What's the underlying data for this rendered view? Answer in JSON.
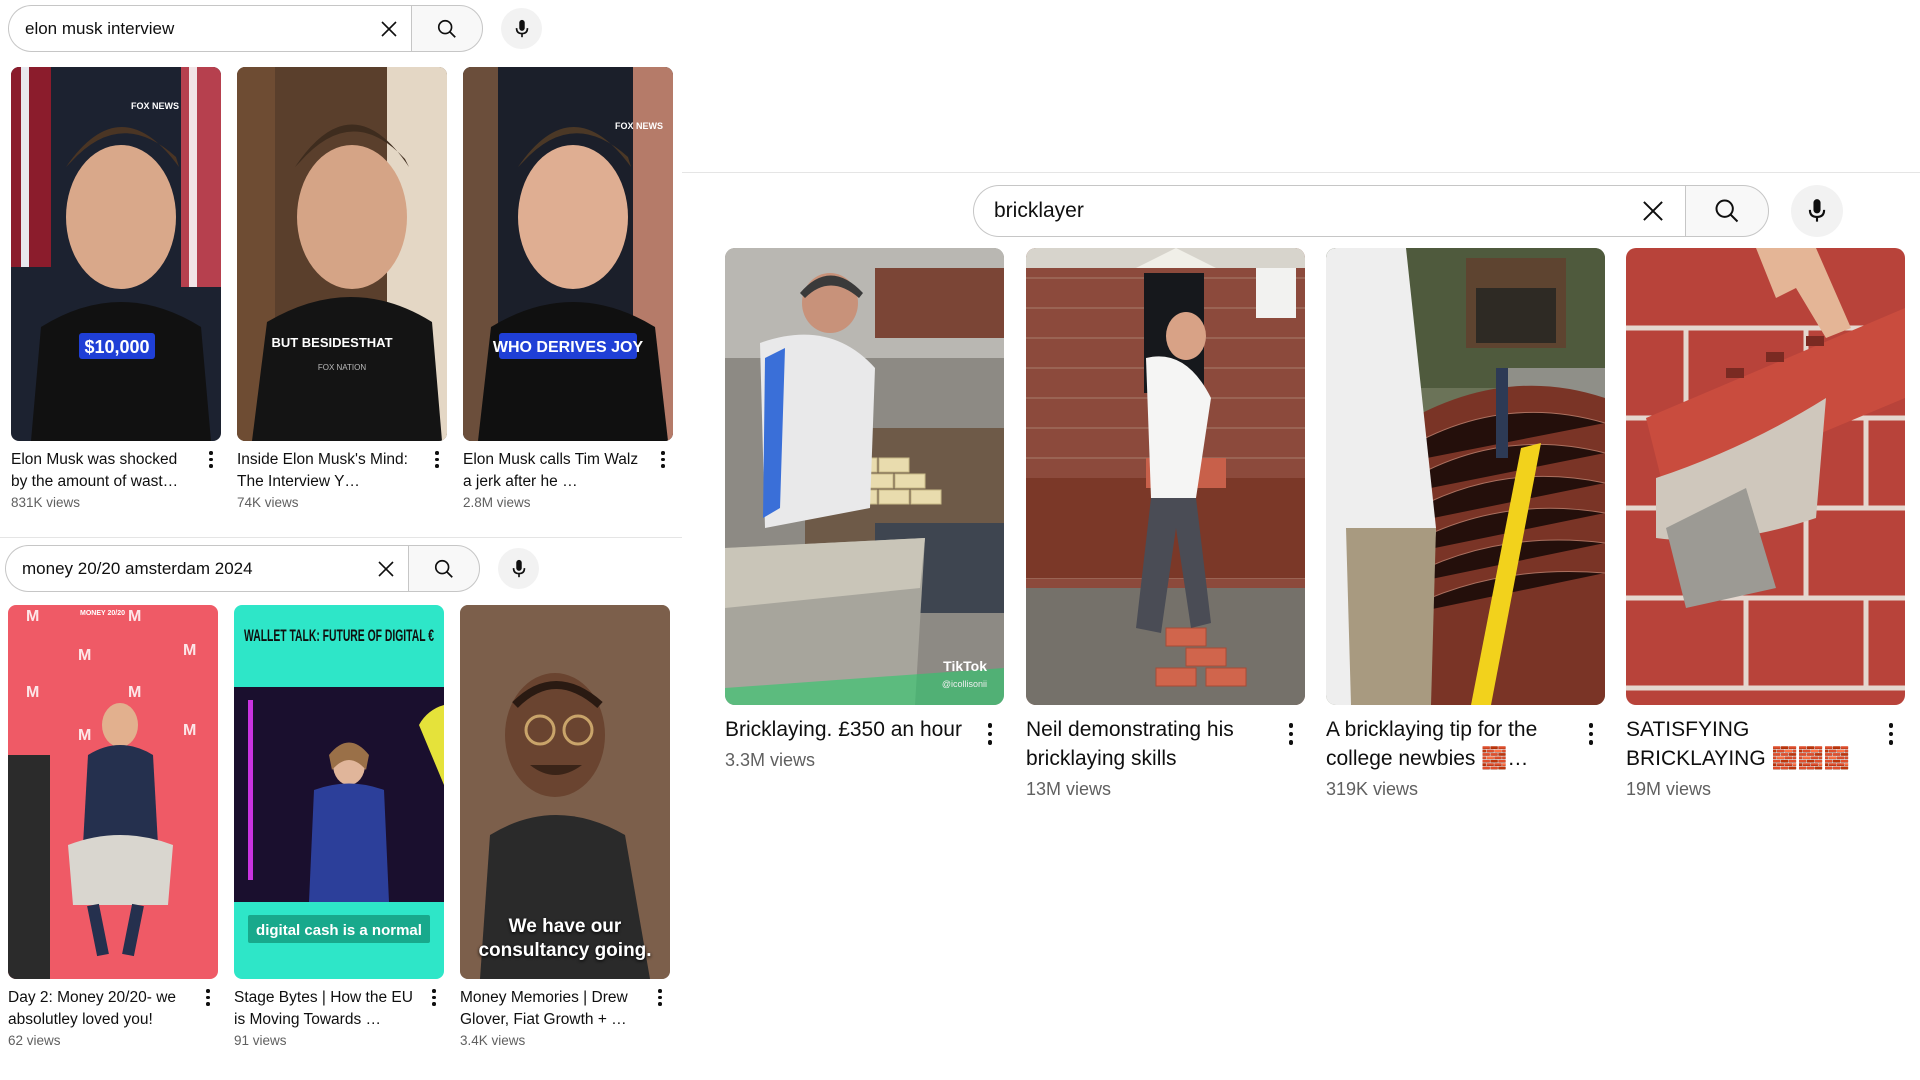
{
  "section1": {
    "search": {
      "query": "elon musk interview"
    },
    "videos": [
      {
        "title": "Elon Musk was shocked by the amount of wast…",
        "views": "831K views",
        "badge": "FOX NEWS",
        "caption": "$10,000"
      },
      {
        "title": "Inside Elon Musk's Mind: The Interview Y…",
        "views": "74K views",
        "caption": "BUT BESIDESTHAT",
        "sub_caption": "FOX NATION"
      },
      {
        "title": "Elon Musk calls Tim Walz a jerk after he …",
        "views": "2.8M views",
        "badge": "FOX NEWS",
        "caption": "WHO DERIVES JOY"
      }
    ]
  },
  "section2": {
    "search": {
      "query": "money 20/20 amsterdam 2024"
    },
    "videos": [
      {
        "title": "Day 2: Money 20/20- we absolutley loved you!",
        "views": "62 views",
        "backdrop_text": "MONEY 20/20"
      },
      {
        "title": "Stage Bytes | How the EU is Moving Towards …",
        "views": "91 views",
        "header": "WALLET TALK: FUTURE OF DIGITAL €",
        "caption": "digital cash is a normal"
      },
      {
        "title": "Money Memories | Drew Glover, Fiat Growth + …",
        "views": "3.4K views",
        "caption": "We have our consultancy going."
      }
    ]
  },
  "section3": {
    "search": {
      "query": "bricklayer"
    },
    "videos": [
      {
        "title": "Bricklaying. £350 an hour",
        "views": "3.3M views",
        "watermark": "TikTok",
        "watermark_user": "@icollisonii"
      },
      {
        "title": "Neil demonstrating his bricklaying skills",
        "views": "13M views"
      },
      {
        "title": "A bricklaying tip for the college newbies 🧱…",
        "views": "319K views"
      },
      {
        "title": "SATISFYING BRICKLAYING 🧱🧱🧱",
        "views": "19M views"
      }
    ]
  },
  "colors": {
    "border": "#c6c6c6",
    "search_button_bg": "#f8f8f8",
    "mic_bg": "#f2f2f2",
    "muted_text": "#606060",
    "teal": "#2ee6c8",
    "fox_caption": "#1f3fd6"
  },
  "icons": {
    "clear": "close-icon",
    "search": "search-icon",
    "mic": "mic-icon",
    "more": "more-vert-icon"
  }
}
